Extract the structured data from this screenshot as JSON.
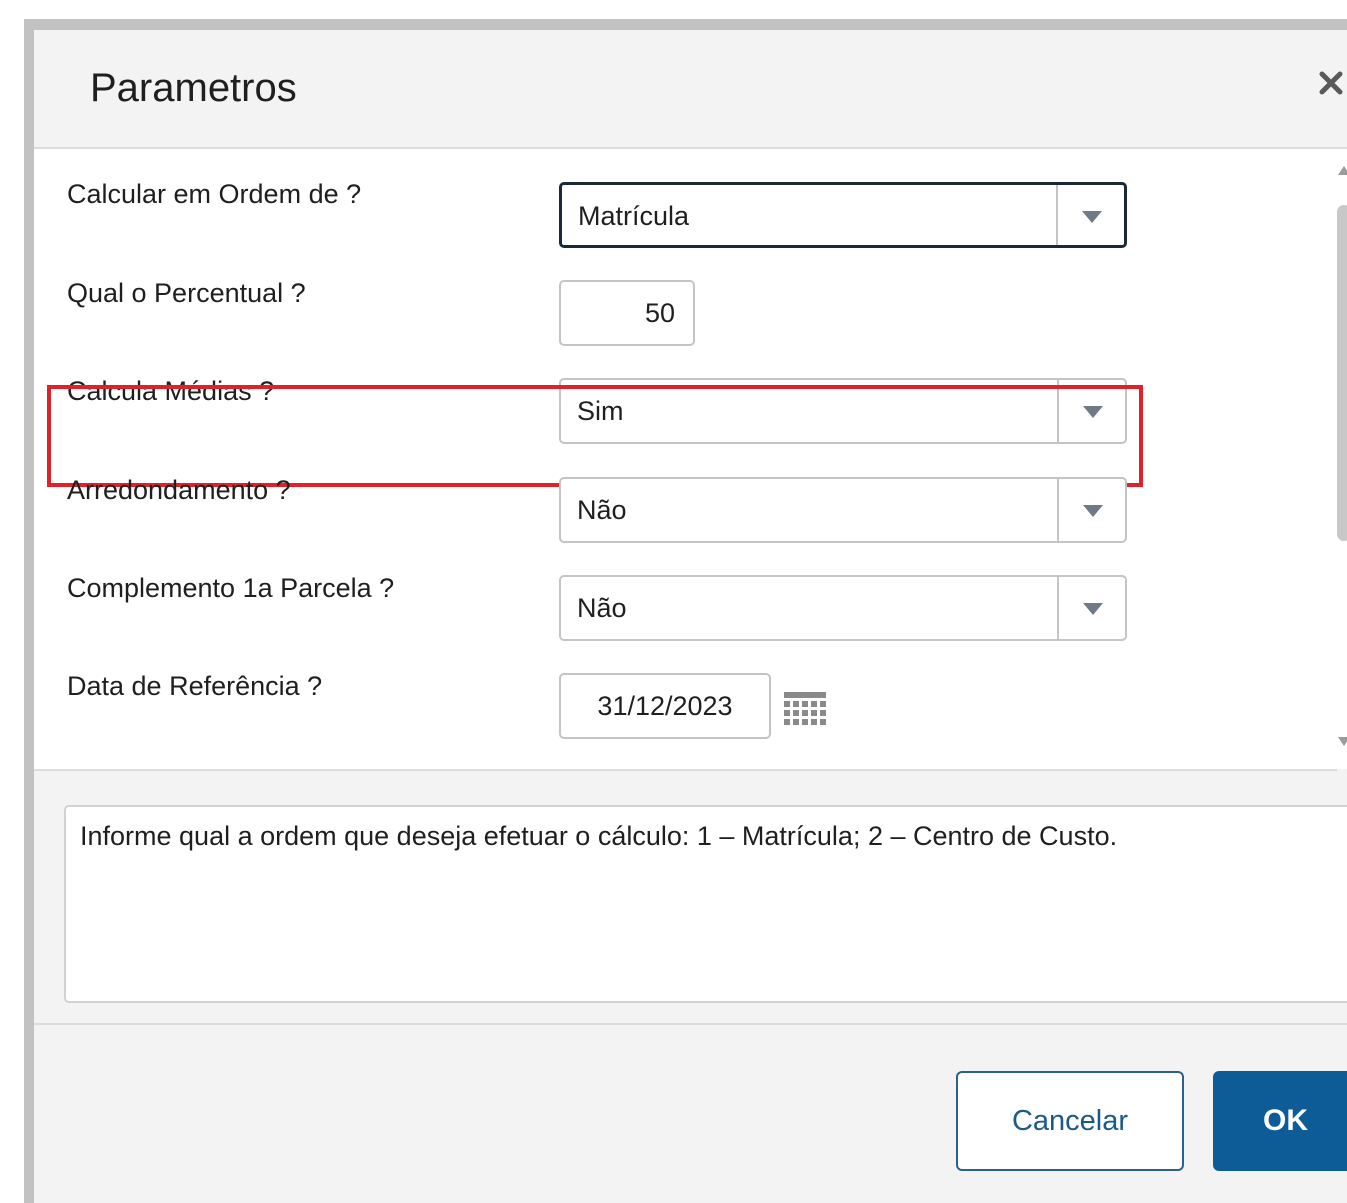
{
  "dialog": {
    "title": "Parametros",
    "close_icon": "close-icon"
  },
  "fields": {
    "order": {
      "label": "Calcular em Ordem de ?",
      "value": "Matrícula"
    },
    "percent": {
      "label": "Qual o Percentual ?",
      "value": "50"
    },
    "averages": {
      "label": "Calcula Médias ?",
      "value": "Sim"
    },
    "rounding": {
      "label": "Arredondamento ?",
      "value": "Não"
    },
    "complement": {
      "label": "Complemento 1a Parcela ?",
      "value": "Não"
    },
    "reference_date": {
      "label": "Data de Referência ?",
      "value": "31/12/2023",
      "icon": "calendar-icon"
    }
  },
  "help": {
    "text": "Informe qual a ordem que deseja efetuar o cálculo: 1 – Matrícula; 2 – Centro de Custo."
  },
  "footer": {
    "cancel_label": "Cancelar",
    "ok_label": "OK"
  },
  "colors": {
    "highlight": "#e0202a",
    "primary": "#0d5c97",
    "focus_border": "#1b2838"
  }
}
